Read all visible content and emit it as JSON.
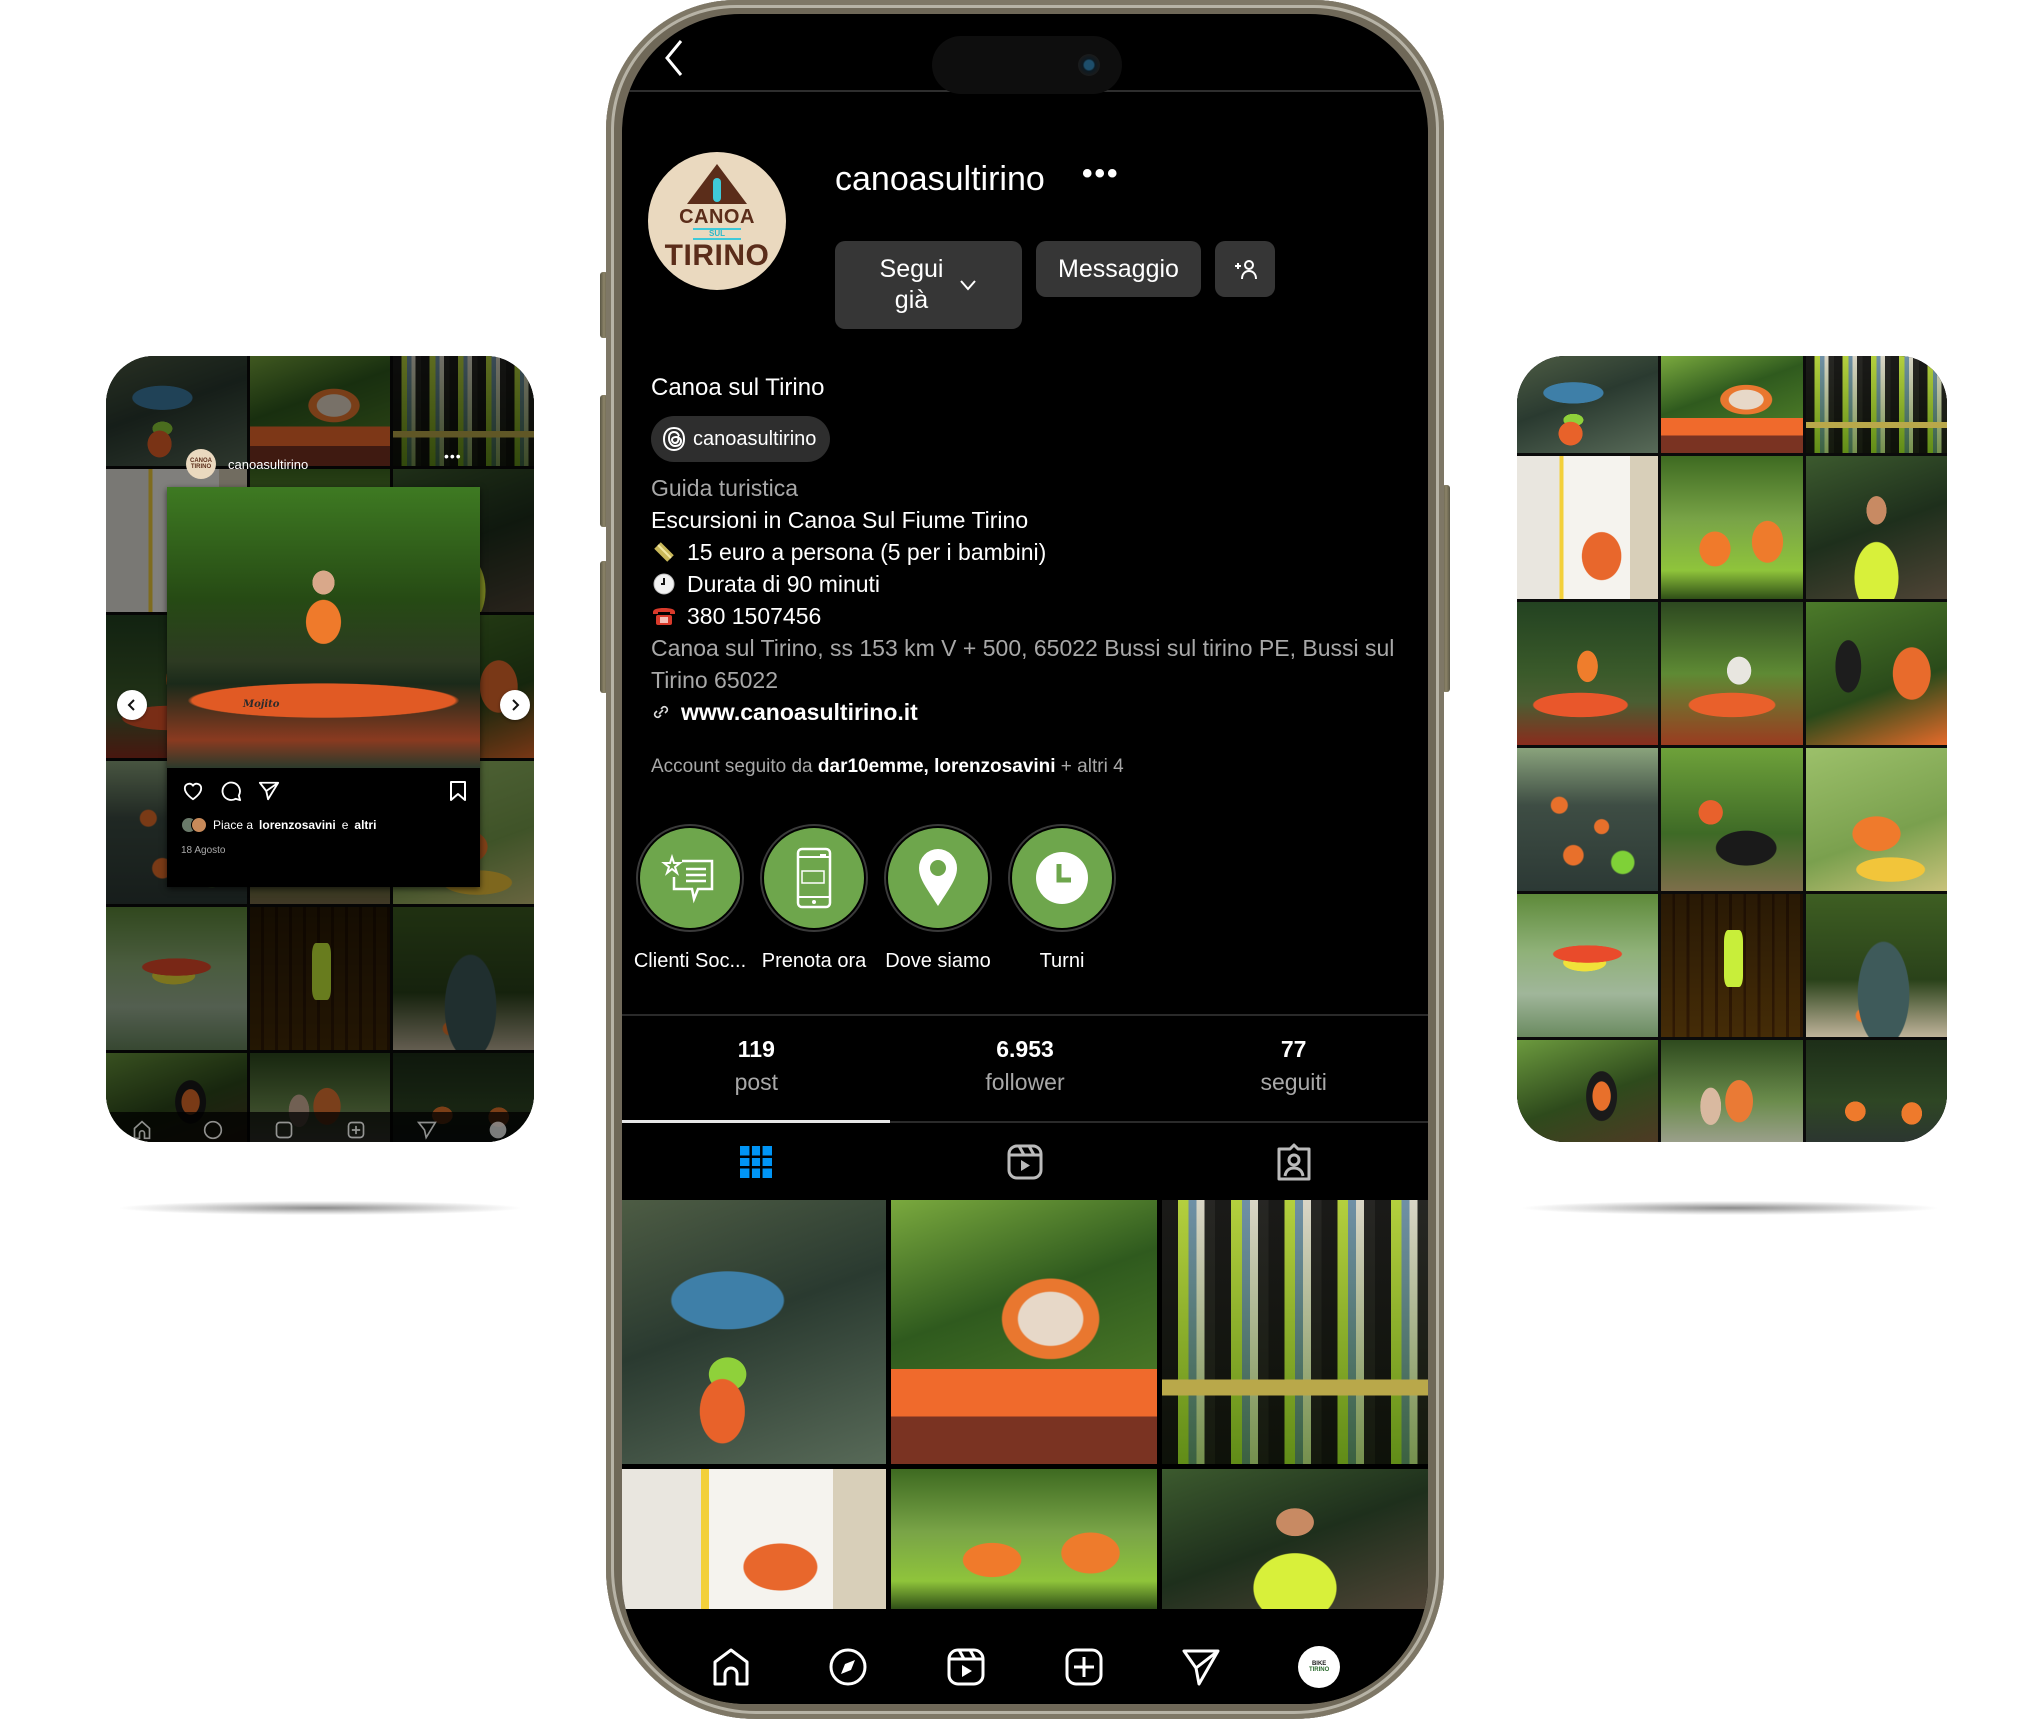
{
  "left_preview": {
    "username": "canoasultirino",
    "avatar_text": "CANOA TIRINO",
    "more_label": "•••",
    "photo_brand_text": "Mojito",
    "likes_prefix": "Piace a",
    "likes_user": "lorenzosavini",
    "likes_connector": "e",
    "likes_suffix": "altri",
    "date": "18 Agosto"
  },
  "profile": {
    "username": "canoasultirino",
    "more_label": "•••",
    "avatar": {
      "line1": "CANOA",
      "line2": "SUL",
      "line3": "TIRINO"
    },
    "buttons": {
      "following_line1": "Segui",
      "following_line2": "già",
      "message": "Messaggio",
      "add_person_label": "+"
    },
    "display_name": "Canoa sul Tirino",
    "threads_handle": "canoasultirino",
    "category": "Guida turistica",
    "bio_lines": [
      {
        "icon": "",
        "text": "Escursioni in Canoa Sul Fiume Tirino"
      },
      {
        "icon": "money-icon",
        "text": "15 euro a persona (5 per i bambini)"
      },
      {
        "icon": "clock-icon",
        "text": "Durata di 90 minuti"
      },
      {
        "icon": "telephone-icon",
        "text": "380 1507456"
      }
    ],
    "address": "Canoa sul Tirino, ss 153 km V + 500, 65022 Bussi sul tirino PE, Bussi sul Tirino 65022",
    "website": "www.canoasultirino.it",
    "followed_by": {
      "prefix": "Account seguito da",
      "user1": "dar10emme",
      "separator": ",",
      "user2": "lorenzosavini",
      "suffix": "+ altri 4"
    },
    "highlights": [
      {
        "label": "Clienti Soc...",
        "icon": "review-star-chat-icon"
      },
      {
        "label": "Prenota ora",
        "icon": "phone-booking-icon"
      },
      {
        "label": "Dove siamo",
        "icon": "location-pin-icon"
      },
      {
        "label": "Turni",
        "icon": "clock-icon"
      }
    ],
    "stats": [
      {
        "value": "119",
        "label": "post"
      },
      {
        "value": "6.953",
        "label": "follower"
      },
      {
        "value": "77",
        "label": "seguiti"
      }
    ],
    "tabs": [
      {
        "name": "grid",
        "icon": "grid-icon",
        "active": true
      },
      {
        "name": "reels",
        "icon": "reels-icon",
        "active": false
      },
      {
        "name": "tagged",
        "icon": "tagged-icon",
        "active": false
      }
    ],
    "bottom_nav": [
      {
        "name": "home",
        "icon": "home-icon"
      },
      {
        "name": "explore",
        "icon": "compass-icon"
      },
      {
        "name": "reels",
        "icon": "reels-icon"
      },
      {
        "name": "create",
        "icon": "plus-square-icon"
      },
      {
        "name": "direct",
        "icon": "send-icon"
      },
      {
        "name": "profile",
        "icon": "profile-avatar-icon"
      }
    ],
    "nav_avatar": {
      "line1": "BIKE",
      "line2": "TIRINO"
    }
  },
  "colors": {
    "highlight_green": "#6ea64c",
    "active_tab_blue": "#0095f6",
    "button_bg": "#363636",
    "phone_frame": "#70695a"
  }
}
